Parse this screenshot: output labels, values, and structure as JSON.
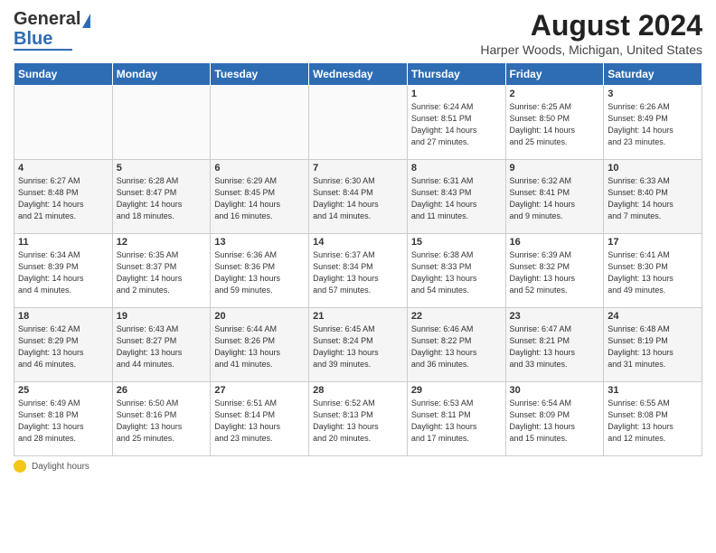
{
  "logo": {
    "line1": "General",
    "line2": "Blue"
  },
  "title": "August 2024",
  "subtitle": "Harper Woods, Michigan, United States",
  "days_header": [
    "Sunday",
    "Monday",
    "Tuesday",
    "Wednesday",
    "Thursday",
    "Friday",
    "Saturday"
  ],
  "weeks": [
    [
      {
        "num": "",
        "info": ""
      },
      {
        "num": "",
        "info": ""
      },
      {
        "num": "",
        "info": ""
      },
      {
        "num": "",
        "info": ""
      },
      {
        "num": "1",
        "info": "Sunrise: 6:24 AM\nSunset: 8:51 PM\nDaylight: 14 hours\nand 27 minutes."
      },
      {
        "num": "2",
        "info": "Sunrise: 6:25 AM\nSunset: 8:50 PM\nDaylight: 14 hours\nand 25 minutes."
      },
      {
        "num": "3",
        "info": "Sunrise: 6:26 AM\nSunset: 8:49 PM\nDaylight: 14 hours\nand 23 minutes."
      }
    ],
    [
      {
        "num": "4",
        "info": "Sunrise: 6:27 AM\nSunset: 8:48 PM\nDaylight: 14 hours\nand 21 minutes."
      },
      {
        "num": "5",
        "info": "Sunrise: 6:28 AM\nSunset: 8:47 PM\nDaylight: 14 hours\nand 18 minutes."
      },
      {
        "num": "6",
        "info": "Sunrise: 6:29 AM\nSunset: 8:45 PM\nDaylight: 14 hours\nand 16 minutes."
      },
      {
        "num": "7",
        "info": "Sunrise: 6:30 AM\nSunset: 8:44 PM\nDaylight: 14 hours\nand 14 minutes."
      },
      {
        "num": "8",
        "info": "Sunrise: 6:31 AM\nSunset: 8:43 PM\nDaylight: 14 hours\nand 11 minutes."
      },
      {
        "num": "9",
        "info": "Sunrise: 6:32 AM\nSunset: 8:41 PM\nDaylight: 14 hours\nand 9 minutes."
      },
      {
        "num": "10",
        "info": "Sunrise: 6:33 AM\nSunset: 8:40 PM\nDaylight: 14 hours\nand 7 minutes."
      }
    ],
    [
      {
        "num": "11",
        "info": "Sunrise: 6:34 AM\nSunset: 8:39 PM\nDaylight: 14 hours\nand 4 minutes."
      },
      {
        "num": "12",
        "info": "Sunrise: 6:35 AM\nSunset: 8:37 PM\nDaylight: 14 hours\nand 2 minutes."
      },
      {
        "num": "13",
        "info": "Sunrise: 6:36 AM\nSunset: 8:36 PM\nDaylight: 13 hours\nand 59 minutes."
      },
      {
        "num": "14",
        "info": "Sunrise: 6:37 AM\nSunset: 8:34 PM\nDaylight: 13 hours\nand 57 minutes."
      },
      {
        "num": "15",
        "info": "Sunrise: 6:38 AM\nSunset: 8:33 PM\nDaylight: 13 hours\nand 54 minutes."
      },
      {
        "num": "16",
        "info": "Sunrise: 6:39 AM\nSunset: 8:32 PM\nDaylight: 13 hours\nand 52 minutes."
      },
      {
        "num": "17",
        "info": "Sunrise: 6:41 AM\nSunset: 8:30 PM\nDaylight: 13 hours\nand 49 minutes."
      }
    ],
    [
      {
        "num": "18",
        "info": "Sunrise: 6:42 AM\nSunset: 8:29 PM\nDaylight: 13 hours\nand 46 minutes."
      },
      {
        "num": "19",
        "info": "Sunrise: 6:43 AM\nSunset: 8:27 PM\nDaylight: 13 hours\nand 44 minutes."
      },
      {
        "num": "20",
        "info": "Sunrise: 6:44 AM\nSunset: 8:26 PM\nDaylight: 13 hours\nand 41 minutes."
      },
      {
        "num": "21",
        "info": "Sunrise: 6:45 AM\nSunset: 8:24 PM\nDaylight: 13 hours\nand 39 minutes."
      },
      {
        "num": "22",
        "info": "Sunrise: 6:46 AM\nSunset: 8:22 PM\nDaylight: 13 hours\nand 36 minutes."
      },
      {
        "num": "23",
        "info": "Sunrise: 6:47 AM\nSunset: 8:21 PM\nDaylight: 13 hours\nand 33 minutes."
      },
      {
        "num": "24",
        "info": "Sunrise: 6:48 AM\nSunset: 8:19 PM\nDaylight: 13 hours\nand 31 minutes."
      }
    ],
    [
      {
        "num": "25",
        "info": "Sunrise: 6:49 AM\nSunset: 8:18 PM\nDaylight: 13 hours\nand 28 minutes."
      },
      {
        "num": "26",
        "info": "Sunrise: 6:50 AM\nSunset: 8:16 PM\nDaylight: 13 hours\nand 25 minutes."
      },
      {
        "num": "27",
        "info": "Sunrise: 6:51 AM\nSunset: 8:14 PM\nDaylight: 13 hours\nand 23 minutes."
      },
      {
        "num": "28",
        "info": "Sunrise: 6:52 AM\nSunset: 8:13 PM\nDaylight: 13 hours\nand 20 minutes."
      },
      {
        "num": "29",
        "info": "Sunrise: 6:53 AM\nSunset: 8:11 PM\nDaylight: 13 hours\nand 17 minutes."
      },
      {
        "num": "30",
        "info": "Sunrise: 6:54 AM\nSunset: 8:09 PM\nDaylight: 13 hours\nand 15 minutes."
      },
      {
        "num": "31",
        "info": "Sunrise: 6:55 AM\nSunset: 8:08 PM\nDaylight: 13 hours\nand 12 minutes."
      }
    ]
  ],
  "footer": {
    "label": "Daylight hours"
  }
}
